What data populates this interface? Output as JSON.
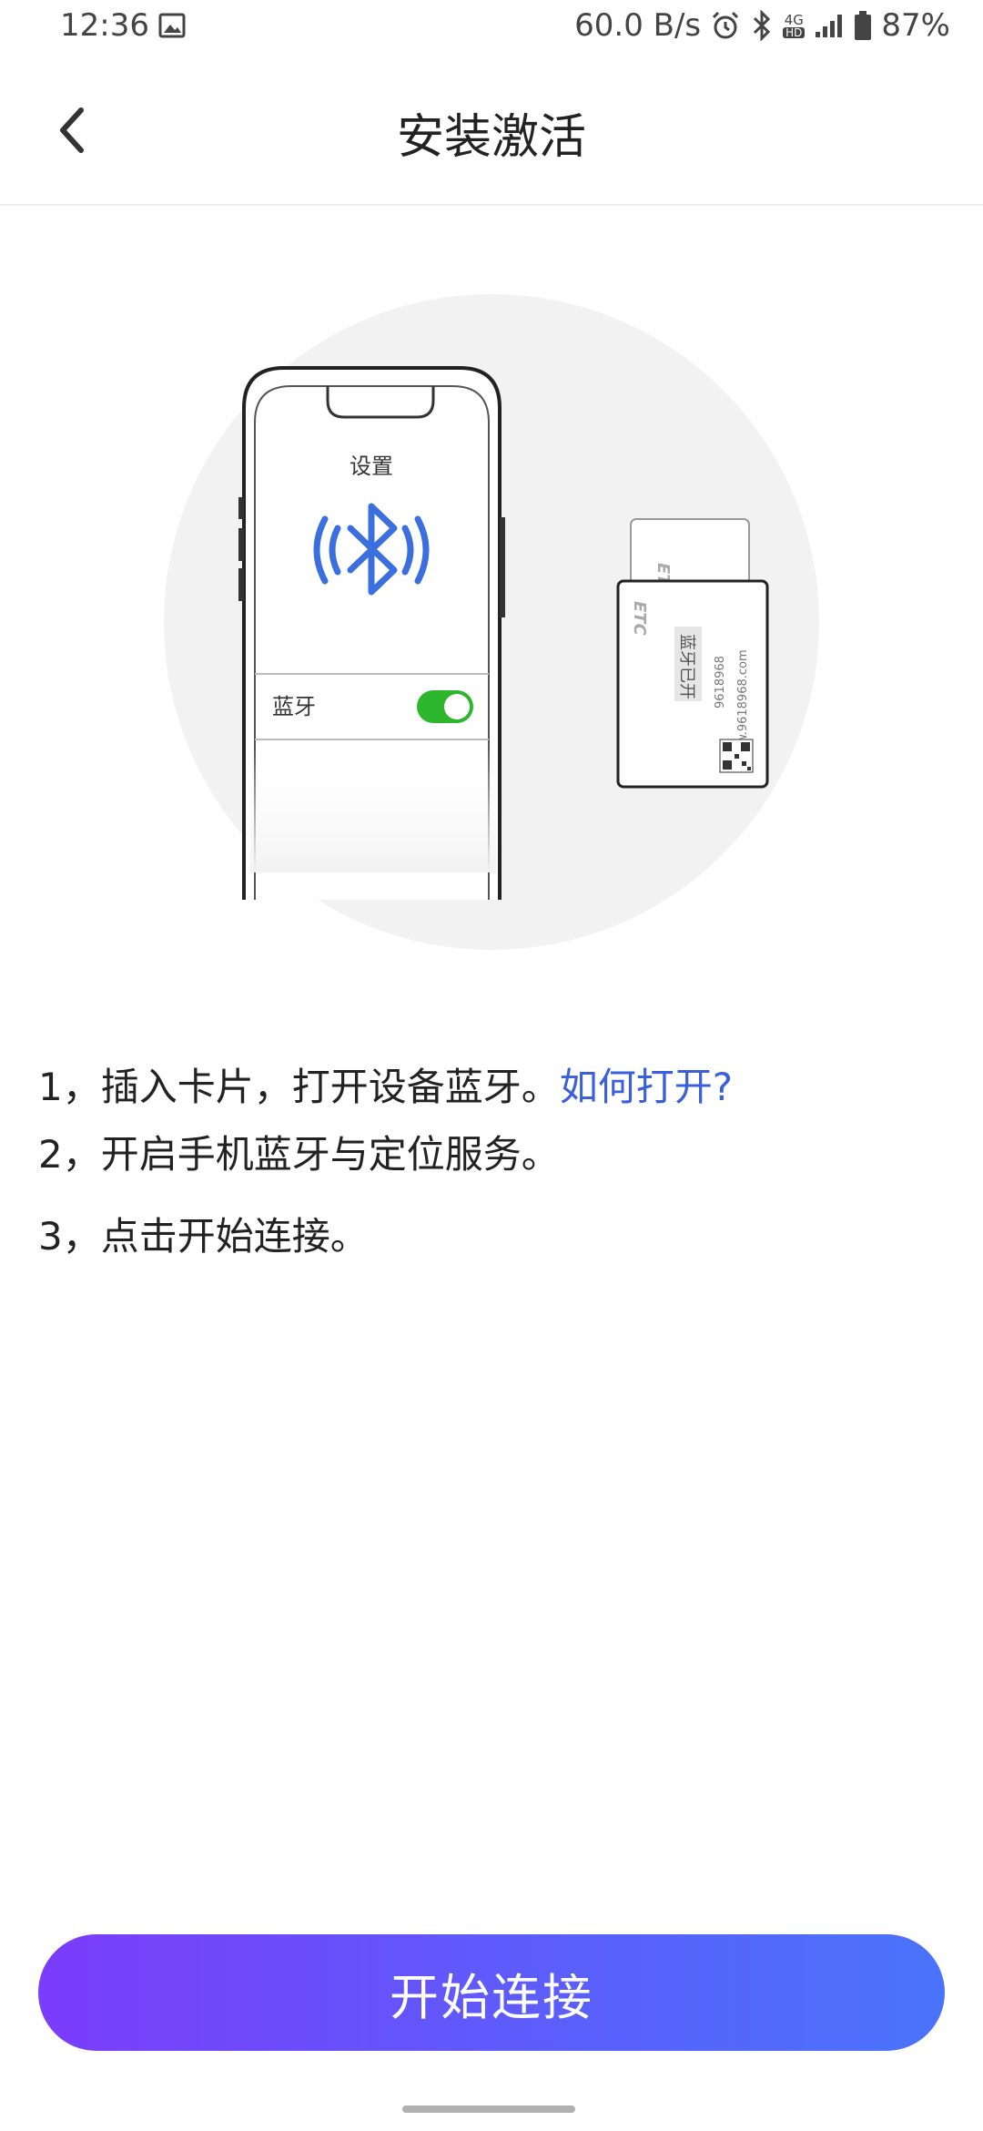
{
  "status_bar": {
    "time": "12:36",
    "net_speed": "60.0 B/s",
    "network": "4G",
    "network_sub": "HD",
    "battery": "87%",
    "icons": [
      "image-icon",
      "alarm-icon",
      "bluetooth-icon",
      "signal-icon",
      "battery-icon"
    ]
  },
  "header": {
    "title": "安装激活",
    "back_icon": "chevron-left-icon"
  },
  "illustration": {
    "phone_screen_title": "设置",
    "bluetooth_row_label": "蓝牙",
    "bluetooth_toggle_on": true,
    "card_brand": "ETC",
    "card_status_text": "蓝牙已开",
    "card_phone": "9618968",
    "card_url": "www.9618968.com",
    "colors": {
      "bluetooth": "#3b6fe0",
      "toggle": "#2db52d",
      "circle": "#f2f2f2"
    }
  },
  "steps": {
    "step1": "1，插入卡片，打开设备蓝牙。",
    "step1_link": "如何打开?",
    "step2": "2，开启手机蓝牙与定位服务。",
    "step3": "3，点击开始连接。"
  },
  "actions": {
    "start_label": "开始连接",
    "gradient": [
      "#7b3cfb",
      "#4a73fb"
    ]
  }
}
